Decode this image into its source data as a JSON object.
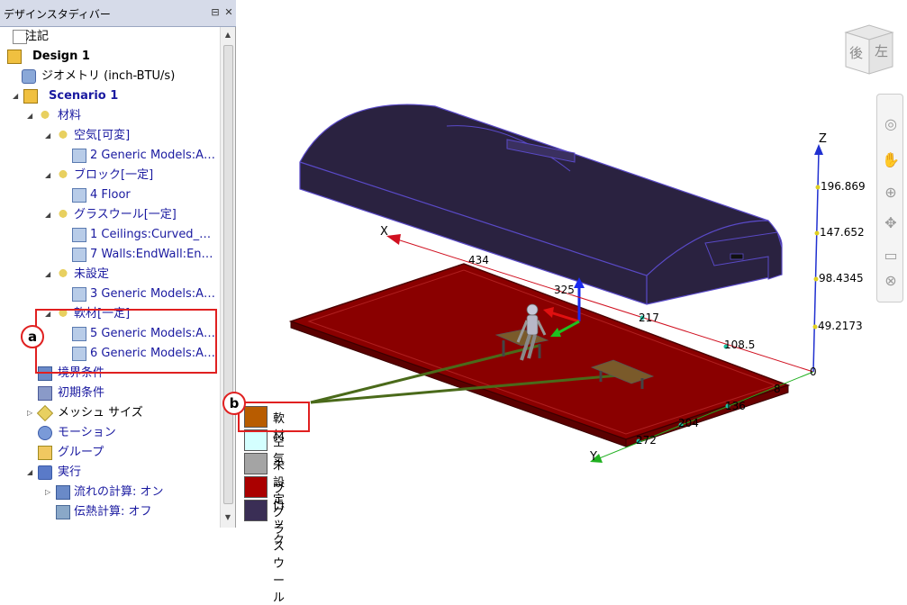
{
  "panel": {
    "title": "デザインスタディバー",
    "pin_glyph": "⊟",
    "close_glyph": "✕",
    "tree": [
      {
        "label": "注記",
        "icon": "notes-icon",
        "arrow": ""
      },
      {
        "label": "Design 1",
        "icon": "folder-design-icon",
        "arrow": ""
      },
      {
        "label": "ジオメトリ (inch-BTU/s)",
        "icon": "geometry-icon",
        "arrow": ""
      },
      {
        "label": "Scenario 1",
        "icon": "folder-scenario-icon",
        "arrow": "◢"
      },
      {
        "label": "材料",
        "icon": "materials-icon",
        "arrow": "◢"
      },
      {
        "label": "空気[可変]",
        "icon": "materials-icon",
        "arrow": "◢"
      },
      {
        "label": "2 Generic Models:A…",
        "icon": "part-icon",
        "arrow": ""
      },
      {
        "label": "ブロック[一定]",
        "icon": "materials-icon",
        "arrow": "◢"
      },
      {
        "label": "4 Floor",
        "icon": "part-icon",
        "arrow": ""
      },
      {
        "label": "グラスウール[一定]",
        "icon": "materials-icon",
        "arrow": "◢"
      },
      {
        "label": "1 Ceilings:Curved_…",
        "icon": "part-icon",
        "arrow": ""
      },
      {
        "label": "7 Walls:EndWall:En…",
        "icon": "part-icon",
        "arrow": ""
      },
      {
        "label": "未設定",
        "icon": "materials-icon",
        "arrow": "◢"
      },
      {
        "label": "3 Generic Models:A…",
        "icon": "part-icon",
        "arrow": ""
      },
      {
        "label": "軟材[一定]",
        "icon": "materials-icon",
        "arrow": "◢"
      },
      {
        "label": "5 Generic Models:A…",
        "icon": "part-icon",
        "arrow": ""
      },
      {
        "label": "6 Generic Models:A…",
        "icon": "part-icon",
        "arrow": ""
      },
      {
        "label": "境界条件",
        "icon": "boundary-icon",
        "arrow": ""
      },
      {
        "label": "初期条件",
        "icon": "initial-icon",
        "arrow": ""
      },
      {
        "label": "メッシュ サイズ",
        "icon": "mesh-icon",
        "arrow": "▷"
      },
      {
        "label": "モーション",
        "icon": "motion-icon",
        "arrow": ""
      },
      {
        "label": "グループ",
        "icon": "group-icon",
        "arrow": ""
      },
      {
        "label": "実行",
        "icon": "solve-icon",
        "arrow": "◢"
      },
      {
        "label": "流れの計算: オン",
        "icon": "flow-icon",
        "arrow": "▷"
      },
      {
        "label": "伝熱計算: オフ",
        "icon": "heat-icon",
        "arrow": ""
      }
    ]
  },
  "markers": {
    "a": "a",
    "b": "b"
  },
  "viewcube": {
    "face1": "後",
    "face2": "左"
  },
  "axes": {
    "x": "X",
    "y": "Y",
    "z": "Z"
  },
  "z_ticks": [
    "196.869",
    "147.652",
    "98.4345",
    "49.2173",
    "0"
  ],
  "x_ticks": [
    "434",
    "325",
    "217",
    "108.5"
  ],
  "y_ticks": [
    "8",
    "136",
    "204",
    "272"
  ],
  "legend": [
    {
      "label": "軟材",
      "color": "#b85c00"
    },
    {
      "label": "空気",
      "color": "#d4ffff"
    },
    {
      "label": "未設定",
      "color": "#a4a4a4"
    },
    {
      "label": "ブロック",
      "color": "#aa0000"
    },
    {
      "label": "グラスウール",
      "color": "#3a2e55"
    }
  ],
  "colors": {
    "roof": "#2a2240",
    "roof_edge": "#5a4ac8",
    "floor": "#8a0000",
    "floor_edge": "#4a0000",
    "annotation": "#e02020",
    "leader": "#4a6a1a"
  }
}
